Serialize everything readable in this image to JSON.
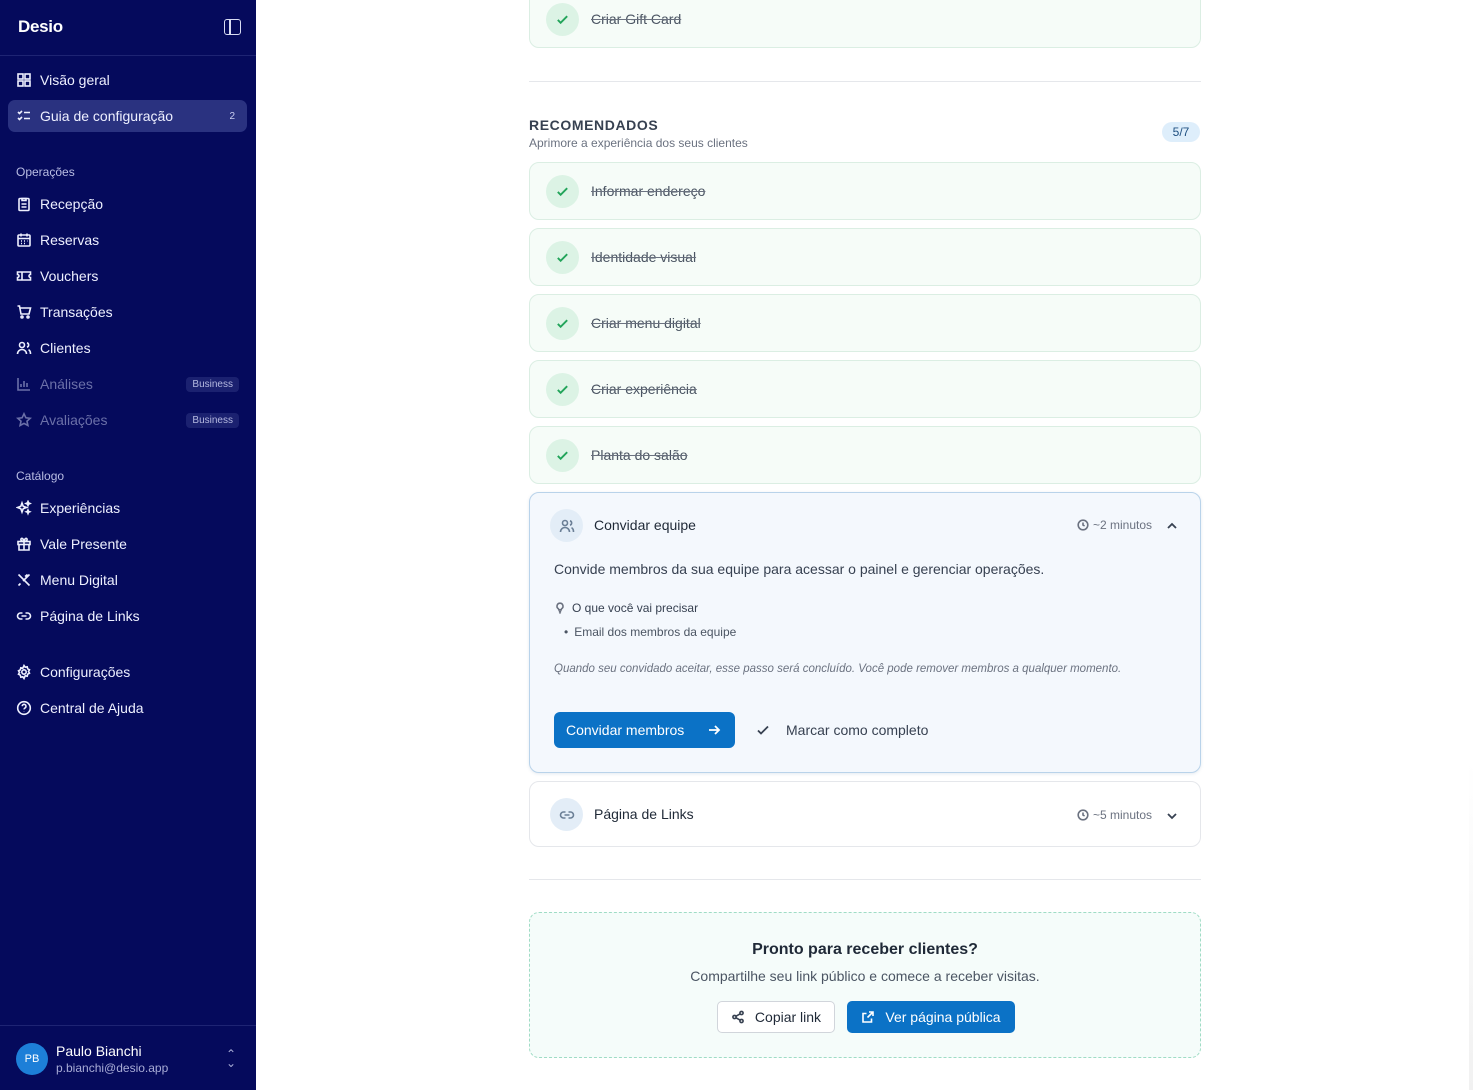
{
  "brand": {
    "name": "Desio"
  },
  "sidebar": {
    "top_items": [
      {
        "label": "Visão geral",
        "icon": "grid-icon"
      },
      {
        "label": "Guia de configuração",
        "icon": "checklist-icon",
        "badge": "2",
        "active": true
      }
    ],
    "sections": {
      "operacoes": {
        "label": "Operações"
      },
      "catalogo": {
        "label": "Catálogo"
      }
    },
    "operacoes_items": [
      {
        "label": "Recepção",
        "icon": "clipboard-icon"
      },
      {
        "label": "Reservas",
        "icon": "calendar-icon"
      },
      {
        "label": "Vouchers",
        "icon": "ticket-icon"
      },
      {
        "label": "Transações",
        "icon": "cart-icon"
      },
      {
        "label": "Clientes",
        "icon": "users-icon"
      },
      {
        "label": "Análises",
        "icon": "chart-icon",
        "pill": "Business",
        "disabled": true
      },
      {
        "label": "Avaliações",
        "icon": "star-icon",
        "pill": "Business",
        "disabled": true
      }
    ],
    "catalogo_items": [
      {
        "label": "Experiências",
        "icon": "sparkles-icon"
      },
      {
        "label": "Vale Presente",
        "icon": "gift-icon"
      },
      {
        "label": "Menu Digital",
        "icon": "utensils-icon"
      },
      {
        "label": "Página de Links",
        "icon": "link-icon"
      }
    ],
    "bottom_items": [
      {
        "label": "Configurações",
        "icon": "gear-icon"
      },
      {
        "label": "Central de Ajuda",
        "icon": "help-icon"
      }
    ],
    "user": {
      "initials": "PB",
      "name": "Paulo Bianchi",
      "email": "p.bianchi@desio.app"
    }
  },
  "main": {
    "previous_card": {
      "title": "Criar Gift Card"
    },
    "recommended": {
      "title": "RECOMENDADOS",
      "subtitle": "Aprimore a experiência dos seus clientes",
      "count": "5/7",
      "done_steps": [
        "Informar endereço",
        "Identidade visual",
        "Criar menu digital",
        "Criar experiência",
        "Planta do salão"
      ],
      "expanded_step": {
        "title": "Convidar equipe",
        "time": "~2 minutos",
        "description": "Convide membros da sua equipe para acessar o painel e gerenciar operações.",
        "need_label": "O que você vai precisar",
        "need_items": [
          "Email dos membros da equipe"
        ],
        "note": "Quando seu convidado aceitar, esse passo será concluído. Você pode remover membros a qualquer momento.",
        "primary_action": "Convidar membros",
        "secondary_action": "Marcar como completo"
      },
      "collapsed_step": {
        "title": "Página de Links",
        "time": "~5 minutos"
      }
    },
    "cta": {
      "title": "Pronto para receber clientes?",
      "subtitle": "Compartilhe seu link público e comece a receber visitas.",
      "copy_label": "Copiar link",
      "view_label": "Ver página pública"
    }
  },
  "colors": {
    "sidebar_bg": "#050a5c",
    "accent": "#0b72c6",
    "success": "#22a45a"
  }
}
